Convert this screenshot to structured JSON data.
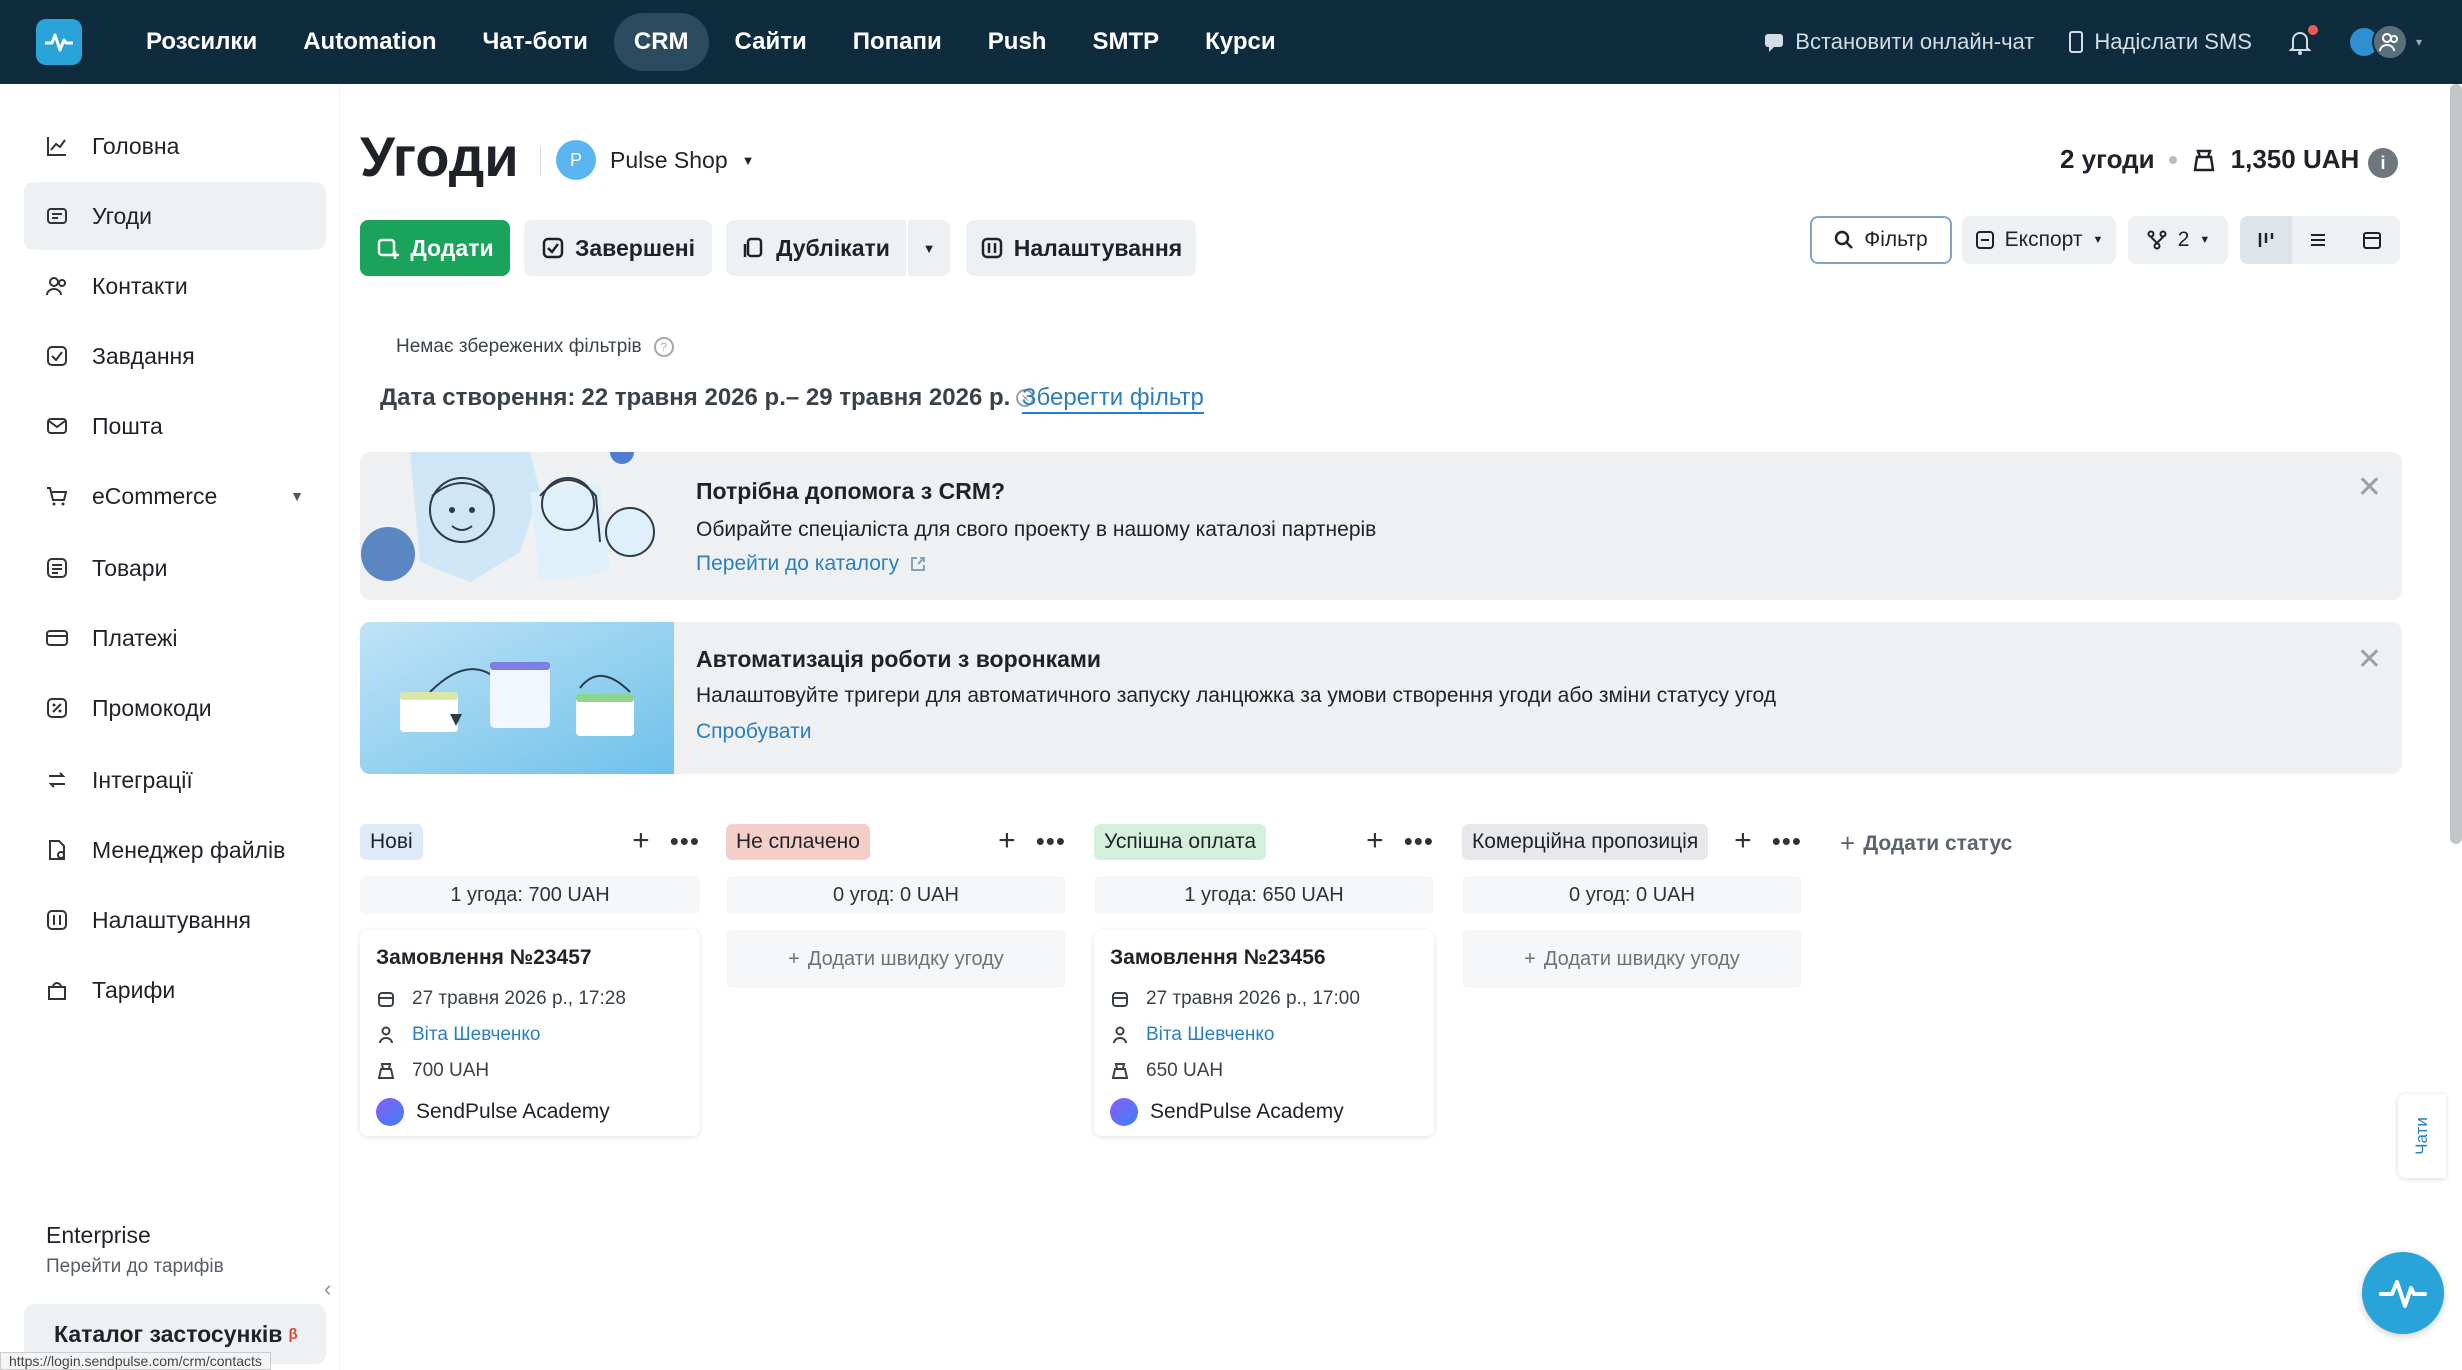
{
  "topnav": {
    "items": [
      "Розсилки",
      "Automation",
      "Чат-боти",
      "CRM",
      "Сайти",
      "Попапи",
      "Push",
      "SMTP",
      "Курси"
    ],
    "active": "CRM",
    "install_chat": "Встановити онлайн-чат",
    "send_sms": "Надіслати SMS"
  },
  "sidebar": {
    "items": [
      {
        "label": "Головна",
        "icon": "chart-line-icon"
      },
      {
        "label": "Угоди",
        "icon": "deals-icon"
      },
      {
        "label": "Контакти",
        "icon": "contacts-icon"
      },
      {
        "label": "Завдання",
        "icon": "tasks-icon"
      },
      {
        "label": "Пошта",
        "icon": "mail-icon"
      },
      {
        "label": "eCommerce",
        "icon": "cart-icon"
      },
      {
        "label": "Товари",
        "icon": "products-icon"
      },
      {
        "label": "Платежі",
        "icon": "payments-icon"
      },
      {
        "label": "Промокоди",
        "icon": "promo-icon"
      },
      {
        "label": "Інтеграції",
        "icon": "integrations-icon"
      },
      {
        "label": "Менеджер файлів",
        "icon": "files-icon"
      },
      {
        "label": "Налаштування",
        "icon": "settings-icon"
      },
      {
        "label": "Тарифи",
        "icon": "tariffs-icon"
      }
    ],
    "active": "Угоди",
    "plan_title": "Enterprise",
    "plan_link": "Перейти до тарифів",
    "catalog": "Каталог застосунків",
    "catalog_badge": "β",
    "status_url": "https://login.sendpulse.com/crm/contacts"
  },
  "header": {
    "title": "Угоди",
    "pipeline_initial": "P",
    "pipeline_name": "Pulse Shop",
    "deals_count": "2 угоди",
    "deals_total": "1,350 UAH"
  },
  "toolbar": {
    "add": "Додати",
    "completed": "Завершені",
    "duplicates": "Дублікати",
    "settings": "Налаштування",
    "filter": "Фільтр",
    "export": "Експорт",
    "branches_count": "2"
  },
  "filters": {
    "no_saved": "Немає збережених фільтрів",
    "date_label": "Дата створення:",
    "date_range": "22 травня 2026 р.– 29 травня 2026 р.",
    "save": "Зберегти фільтр"
  },
  "banners": [
    {
      "title": "Потрібна допомога з CRM?",
      "text": "Обирайте спеціаліста для свого проекту в нашому каталозі партнерів",
      "link": "Перейти до каталогу"
    },
    {
      "title": "Автоматизація роботи з воронками",
      "text": "Налаштовуйте тригери для автоматичного запуску ланцюжка за умови створення угоди або зміни статусу угод",
      "link": "Спробувати"
    }
  ],
  "kanban": {
    "add_status": "Додати статус",
    "quick_add": "Додати швидку угоду",
    "columns": [
      {
        "name": "Нові",
        "bg": "#dcebf7",
        "fg": "#1f2329",
        "summary": "1 угода: 700 UAH",
        "card": {
          "title": "Замовлення №23457",
          "date": "27 травня 2026 р., 17:28",
          "contact": "Віта Шевченко",
          "amount": "700 UAH",
          "source": "SendPulse Academy"
        }
      },
      {
        "name": "Не сплачено",
        "bg": "#f4cfc9",
        "fg": "#1f2329",
        "summary": "0 угод: 0 UAH"
      },
      {
        "name": "Успішна оплата",
        "bg": "#d4f0dc",
        "fg": "#1f2329",
        "summary": "1 угода: 650 UAH",
        "card": {
          "title": "Замовлення №23456",
          "date": "27 травня 2026 р., 17:00",
          "contact": "Віта Шевченко",
          "amount": "650 UAH",
          "source": "SendPulse Academy"
        }
      },
      {
        "name": "Комерційна пропозиція",
        "bg": "#e6e8eb",
        "fg": "#1f2329",
        "summary": "0 угод: 0 UAH"
      }
    ]
  },
  "chats_tab": "Чати"
}
